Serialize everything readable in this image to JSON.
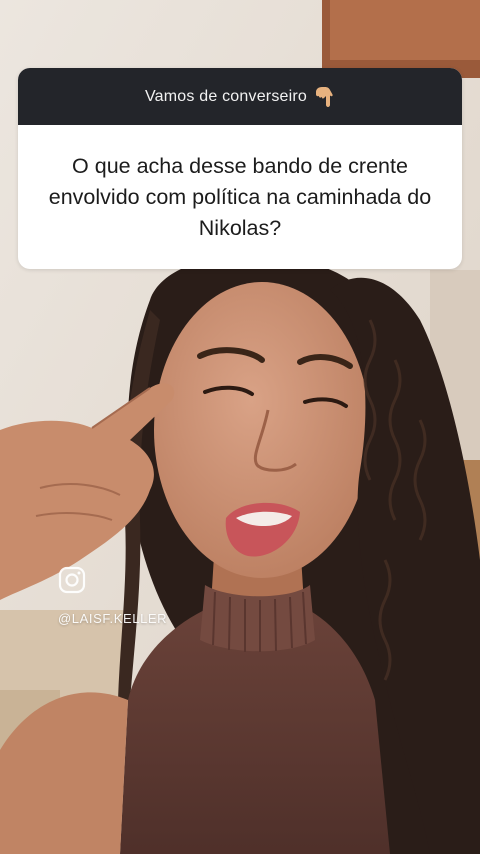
{
  "sticker": {
    "header": "Vamos de converseiro",
    "header_icon": "hand-pointing-down-icon",
    "question": "O que acha desse bando de crente envolvido com política na caminhada do Nikolas?"
  },
  "watermark": {
    "icon": "instagram-icon",
    "handle": "@LAISF.KELLER"
  },
  "colors": {
    "sticker_header_bg": "#23252a",
    "sticker_body_bg": "#ffffff",
    "sweater": "#5e3a33",
    "hair": "#2a1d18",
    "skin": "#c98f70"
  }
}
